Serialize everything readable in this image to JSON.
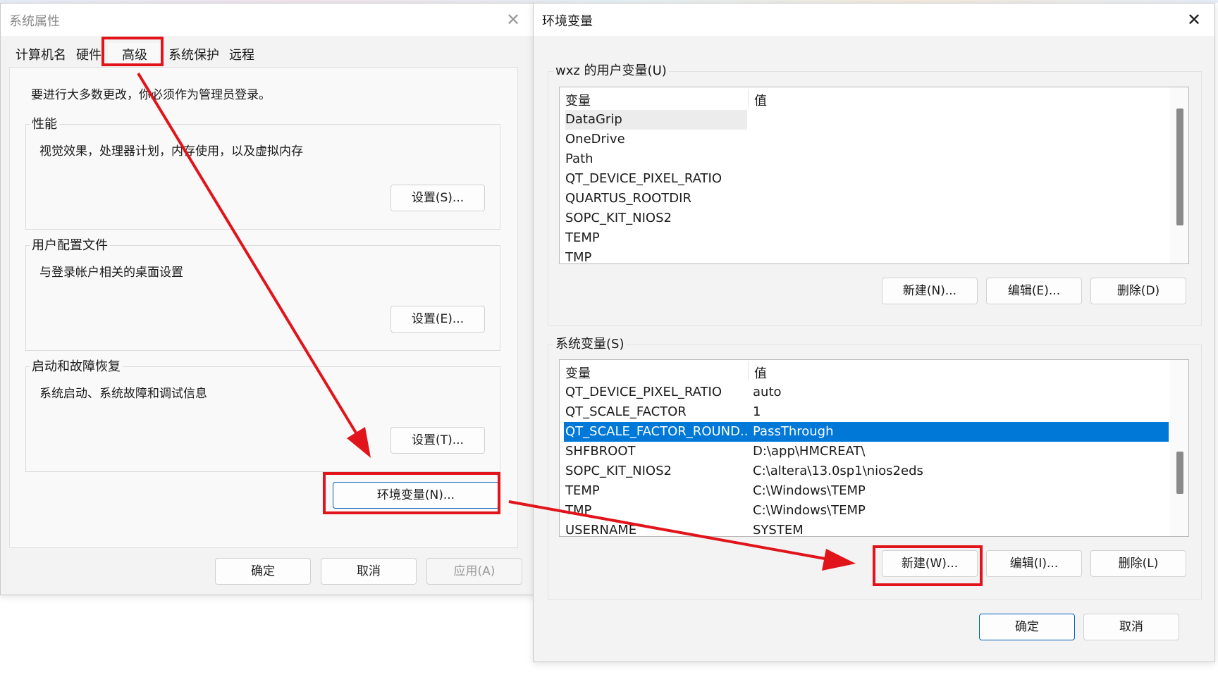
{
  "sysprops": {
    "title": "系统属性",
    "tabs": [
      "计算机名",
      "硬件",
      "高级",
      "系统保护",
      "远程"
    ],
    "admin_note": "要进行大多数更改，你必须作为管理员登录。",
    "performance": {
      "label": "性能",
      "desc": "视觉效果，处理器计划，内存使用，以及虚拟内存",
      "button": "设置(S)..."
    },
    "profiles": {
      "label": "用户配置文件",
      "desc": "与登录帐户相关的桌面设置",
      "button": "设置(E)..."
    },
    "startup": {
      "label": "启动和故障恢复",
      "desc": "系统启动、系统故障和调试信息",
      "button": "设置(T)..."
    },
    "env_button": "环境变量(N)...",
    "ok": "确定",
    "cancel": "取消",
    "apply": "应用(A)"
  },
  "envvars": {
    "title": "环境变量",
    "user_section": {
      "label": "wxz 的用户变量(U)",
      "col_var": "变量",
      "col_val": "值",
      "rows": [
        {
          "name": "DataGrip",
          "value": ""
        },
        {
          "name": "OneDrive",
          "value": ""
        },
        {
          "name": "Path",
          "value": ""
        },
        {
          "name": "QT_DEVICE_PIXEL_RATIO",
          "value": ""
        },
        {
          "name": "QUARTUS_ROOTDIR",
          "value": ""
        },
        {
          "name": "SOPC_KIT_NIOS2",
          "value": ""
        },
        {
          "name": "TEMP",
          "value": ""
        },
        {
          "name": "TMP",
          "value": ""
        }
      ],
      "new": "新建(N)...",
      "edit": "编辑(E)...",
      "delete": "删除(D)"
    },
    "sys_section": {
      "label": "系统变量(S)",
      "col_var": "变量",
      "col_val": "值",
      "rows": [
        {
          "name": "QT_DEVICE_PIXEL_RATIO",
          "value": "auto"
        },
        {
          "name": "QT_SCALE_FACTOR",
          "value": "1"
        },
        {
          "name": "QT_SCALE_FACTOR_ROUND...",
          "value": "PassThrough"
        },
        {
          "name": "SHFBROOT",
          "value": "D:\\app\\HMCREAT\\"
        },
        {
          "name": "SOPC_KIT_NIOS2",
          "value": "C:\\altera\\13.0sp1\\nios2eds"
        },
        {
          "name": "TEMP",
          "value": "C:\\Windows\\TEMP"
        },
        {
          "name": "TMP",
          "value": "C:\\Windows\\TEMP"
        },
        {
          "name": "USERNAME",
          "value": "SYSTEM"
        }
      ],
      "selected_row": "QT_SCALE_FACTOR_ROUND...",
      "new": "新建(W)...",
      "edit": "编辑(I)...",
      "delete": "删除(L)"
    },
    "ok": "确定",
    "cancel": "取消"
  },
  "colors": {
    "annotation_red": "#e0141a",
    "selection_blue": "#0078d7",
    "primary_border": "#005fb8"
  }
}
